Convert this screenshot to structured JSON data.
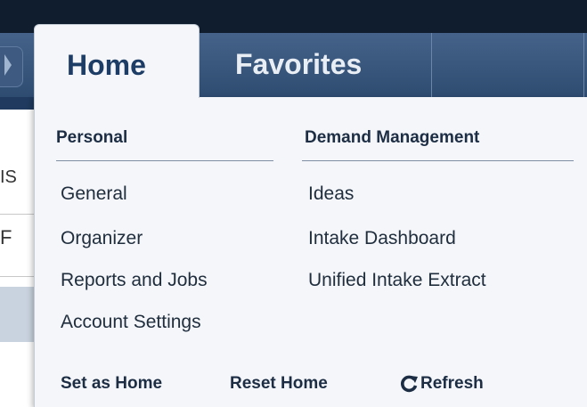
{
  "tabs": [
    {
      "label": "Home",
      "active": true
    },
    {
      "label": "Favorites",
      "active": false
    }
  ],
  "menu": {
    "columns": [
      {
        "header": "Personal",
        "items": [
          "General",
          "Organizer",
          "Reports and Jobs",
          "Account Settings"
        ]
      },
      {
        "header": "Demand Management",
        "items": [
          "Ideas",
          "Intake Dashboard",
          "Unified Intake Extract"
        ]
      }
    ],
    "footer": {
      "set_home": "Set as Home",
      "reset_home": "Reset Home",
      "refresh": "Refresh"
    }
  },
  "background": {
    "fragment_1": "IS",
    "fragment_2": "F"
  },
  "icons": {
    "refresh": "refresh-icon",
    "nav_chevron": "chevron-right-icon"
  },
  "colors": {
    "header_dark": "#0f1d2e",
    "nav_blue": "#3a587e",
    "panel_bg": "#f4f6f9",
    "active_tab_text": "#1d3d66"
  }
}
